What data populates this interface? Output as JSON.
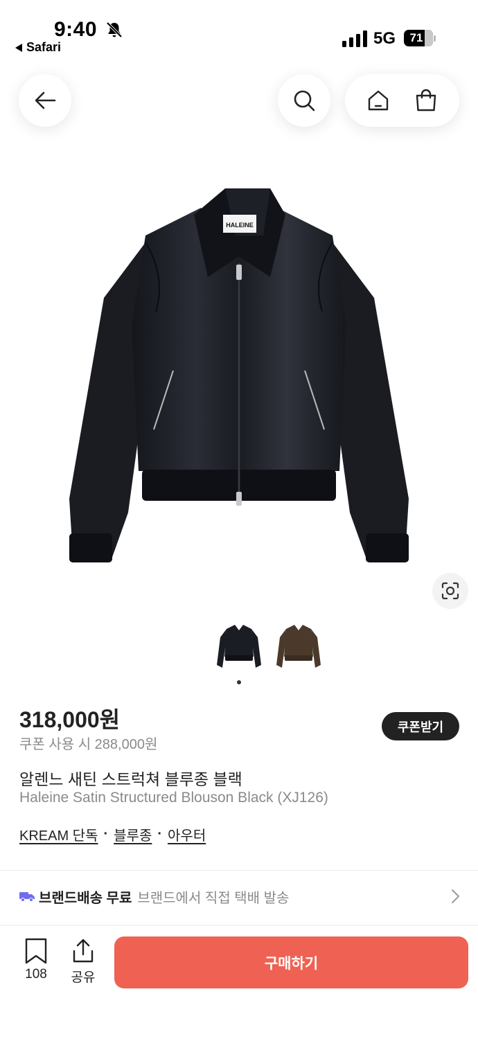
{
  "status_bar": {
    "time": "9:40",
    "back_app": "Safari",
    "network": "5G",
    "battery": "71",
    "battery_level": 0.71
  },
  "icons": {
    "bell": "bell-slash-icon",
    "back": "arrow-left-icon",
    "search": "search-icon",
    "home": "home-icon",
    "bag": "shopping-bag-icon",
    "lens": "image-search-icon",
    "bookmark": "bookmark-icon",
    "share": "share-icon",
    "truck": "truck-icon",
    "chevron": "chevron-right-icon"
  },
  "product": {
    "label_text": "HALEINE",
    "thumbnails": [
      {
        "name": "black",
        "color": "#1b1d24"
      },
      {
        "name": "brown",
        "color": "#4b3a2b"
      }
    ],
    "price": "318,000원",
    "coupon_price": "쿠폰 사용 시 288,000원",
    "coupon_button": "쿠폰받기",
    "title_ko": "알렌느 새틴 스트럭쳐 블루종 블랙",
    "title_en": "Haleine Satin Structured Blouson Black (XJ126)",
    "tags": [
      "KREAM 단독",
      "블루종",
      "아우터"
    ],
    "tag_separator": "·"
  },
  "shipping": {
    "title": "브랜드배송 무료",
    "description": "브랜드에서 직접 택배 발송"
  },
  "bottom_bar": {
    "save_count": "108",
    "share_label": "공유",
    "buy_label": "구매하기"
  },
  "colors": {
    "accent": "#ef6253",
    "truck": "#6f6cf0",
    "dark": "#222222"
  }
}
